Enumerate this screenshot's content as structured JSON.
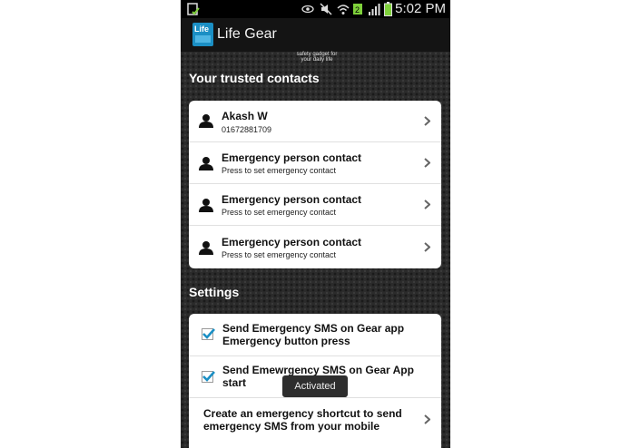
{
  "status_bar": {
    "time": "5:02 PM",
    "icons": [
      "gallery-notification-icon",
      "eye-icon",
      "mute-icon",
      "wifi-icon",
      "data-icon",
      "signal-icon",
      "battery-icon"
    ]
  },
  "app_bar": {
    "logo_text": "Life",
    "title": "Life Gear"
  },
  "banner": {
    "tagline_line1": "safety gadget for",
    "tagline_line2": "your daily life"
  },
  "contacts_section": {
    "header": "Your trusted contacts",
    "items": [
      {
        "name": "Akash W",
        "detail": "01672881709"
      },
      {
        "name": "Emergency person contact",
        "detail": "Press to set emergency contact"
      },
      {
        "name": "Emergency person contact",
        "detail": "Press to set emergency contact"
      },
      {
        "name": "Emergency person contact",
        "detail": "Press to set emergency contact"
      }
    ]
  },
  "settings_section": {
    "header": "Settings",
    "items": [
      {
        "line1": "Send Emergency SMS on Gear app",
        "line2": "Emergency button press",
        "checked": true
      },
      {
        "line1": "Send Emewrgency SMS on Gear App",
        "line2": "start",
        "checked": true
      }
    ],
    "shortcut": {
      "line1": "Create an emergency shortcut to send",
      "line2": "emergency SMS from your mobile"
    }
  },
  "toast": {
    "text": "Activated"
  },
  "colors": {
    "check_accent": "#1b8fc4",
    "logo_blue": "#1b8fc4"
  }
}
